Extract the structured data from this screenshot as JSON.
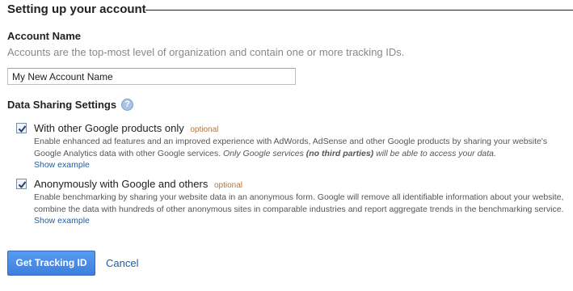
{
  "section": {
    "title": "Setting up your account"
  },
  "account": {
    "label": "Account Name",
    "description": "Accounts are the top-most level of organization and contain one or more tracking IDs.",
    "input_value": "My New Account Name"
  },
  "data_sharing": {
    "label": "Data Sharing Settings",
    "help_icon": "question-mark-icon",
    "options": [
      {
        "title": "With other Google products only",
        "optional": "optional",
        "checked": true,
        "desc_plain": "Enable enhanced ad features and an improved experience with AdWords, AdSense and other Google products by sharing your website's Google Analytics data with other Google services.",
        "desc_italic_a": "Only Google services",
        "desc_bold_italic": "(no third parties)",
        "desc_italic_b": "will be able to access your data.",
        "show_example": "Show example"
      },
      {
        "title": "Anonymously with Google and others",
        "optional": "optional",
        "checked": true,
        "desc_plain": "Enable benchmarking by sharing your website data in an anonymous form. Google will remove all identifiable information about your website, combine the data with hundreds of other anonymous sites in comparable industries and report aggregate trends in the benchmarking service.",
        "show_example": "Show example"
      }
    ]
  },
  "actions": {
    "primary": "Get Tracking ID",
    "cancel": "Cancel"
  },
  "colors": {
    "link": "#1a5fa6",
    "optional": "#b87333",
    "button": "#4a8cec"
  }
}
